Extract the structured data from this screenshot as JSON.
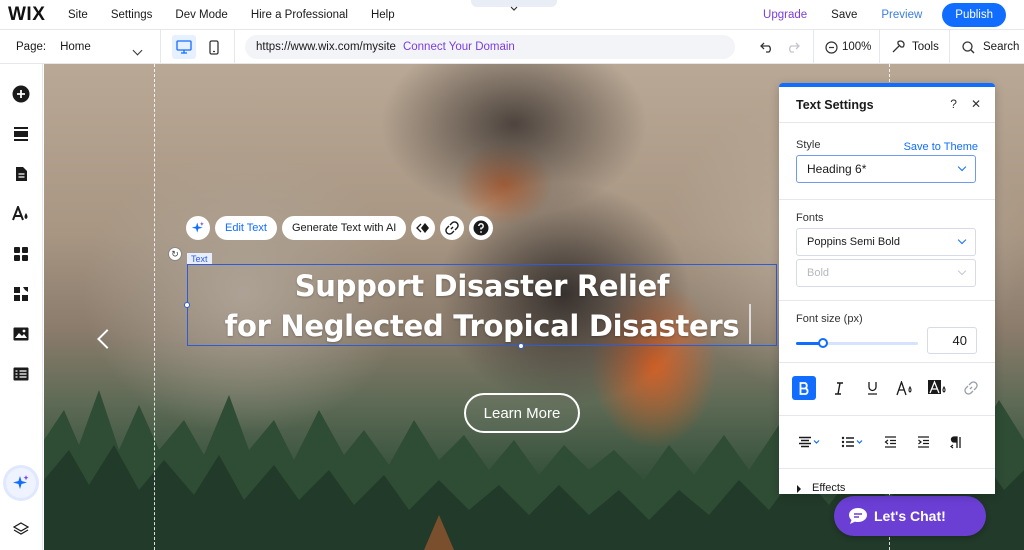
{
  "topbar": {
    "logo": "WIX",
    "menu": [
      "Site",
      "Settings",
      "Dev Mode",
      "Hire a Professional",
      "Help"
    ],
    "upgrade": "Upgrade",
    "save": "Save",
    "preview": "Preview",
    "publish": "Publish"
  },
  "toolbar": {
    "page_label": "Page:",
    "page_value": "Home",
    "url": "https://www.wix.com/mysite",
    "connect_domain": "Connect Your Domain",
    "zoom": "100%",
    "tools": "Tools",
    "search": "Search"
  },
  "canvas": {
    "float_bar": {
      "edit_text": "Edit Text",
      "generate_text": "Generate Text with AI"
    },
    "text_tag": "Text",
    "hero_line1": "Support Disaster Relief",
    "hero_line2": "for Neglected Tropical Disasters",
    "learn_more": "Learn More",
    "chat": "Let's Chat!"
  },
  "panel": {
    "title": "Text Settings",
    "style_label": "Style",
    "save_to_theme": "Save to Theme",
    "style_value": "Heading 6*",
    "fonts_label": "Fonts",
    "font_value": "Poppins Semi Bold",
    "weight_value": "Bold",
    "font_size_label": "Font size (px)",
    "font_size_value": "40",
    "font_size_slider_fraction": 0.22,
    "effects": "Effects"
  },
  "colors": {
    "accent": "#116dff",
    "upgrade_purple": "#7a3ee0",
    "chat_purple": "#6b3fd4"
  }
}
